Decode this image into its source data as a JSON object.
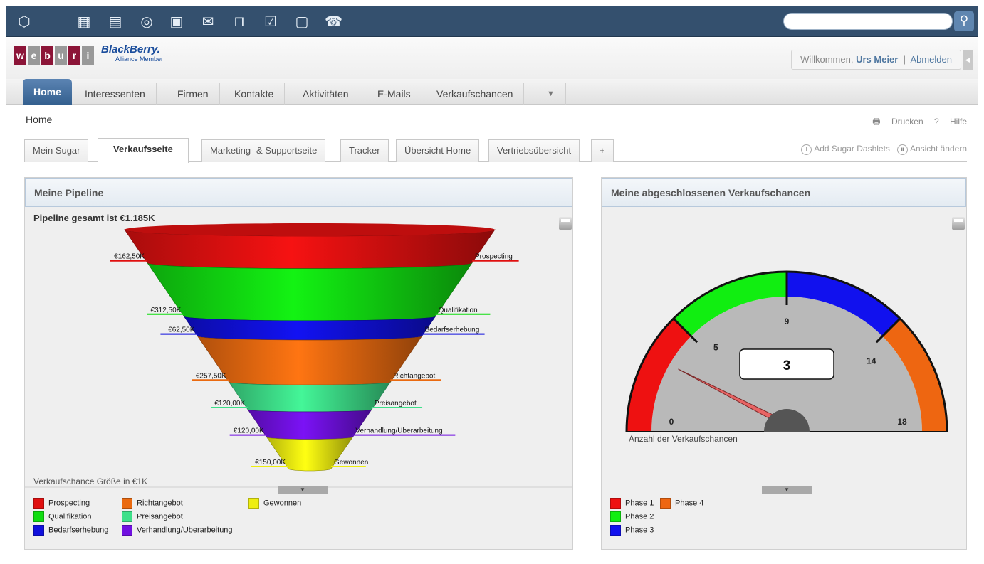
{
  "topbar": {
    "icons": [
      "cube-icon",
      "building-icon",
      "contact-card-icon",
      "coins-icon",
      "briefcase-icon",
      "envelope-icon",
      "clip-icon",
      "checklist-icon",
      "calendar-icon",
      "phone-icon"
    ],
    "search_placeholder": ""
  },
  "brand": {
    "logo_letters": [
      "w",
      "e",
      "b",
      "u",
      "r",
      "i"
    ],
    "logo_colors": [
      "#8c1538",
      "#999999",
      "#8c1538",
      "#999999",
      "#8c1538",
      "#999999"
    ],
    "partner_name": "BlackBerry.",
    "partner_sub": "Alliance Member"
  },
  "user": {
    "welcome": "Willkommen,",
    "name": "Urs Meier",
    "logout": "Abmelden"
  },
  "nav": {
    "tabs": [
      "Home",
      "Interessenten",
      "Firmen",
      "Kontakte",
      "Aktivitäten",
      "E-Mails",
      "Verkaufschancen"
    ],
    "active": "Home"
  },
  "page": {
    "title": "Home",
    "print": "Drucken",
    "help": "Hilfe"
  },
  "dashboard_tabs": {
    "tabs": [
      "Mein Sugar",
      "Verkaufsseite",
      "Marketing- & Supportseite",
      "Tracker",
      "Übersicht Home",
      "Vertriebsübersicht"
    ],
    "active": "Verkaufsseite",
    "add_label": "+",
    "add_dashlets": "Add Sugar Dashlets",
    "change_view": "Ansicht ändern"
  },
  "pipeline": {
    "header": "Meine Pipeline",
    "subtitle": "Pipeline gesamt ist €1.185K",
    "xlabel": "Verkaufschance Größe in €1K"
  },
  "gauge_dashlet": {
    "header": "Meine abgeschlossenen Verkaufschancen",
    "xlabel": "Anzahl der Verkaufschancen"
  },
  "chart_data": [
    {
      "type": "funnel",
      "title": "Pipeline gesamt ist €1.185K",
      "xlabel": "Verkaufschance Größe in €1K",
      "categories": [
        "Prospecting",
        "Qualifikation",
        "Bedarfserhebung",
        "Richtangebot",
        "Preisangebot",
        "Verhandlung/Überarbeitung",
        "Gewonnen"
      ],
      "values": [
        162.5,
        312.5,
        62.5,
        257.5,
        120.0,
        120.0,
        150.0
      ],
      "value_labels": [
        "€162,50K",
        "€312,50K",
        "€62,50K",
        "€257,50K",
        "€120,00K",
        "€120,00K",
        "€150,00K"
      ],
      "colors": [
        "#e01010",
        "#11dd11",
        "#1010dd",
        "#ea6a10",
        "#3ee08a",
        "#7010e0",
        "#eeee10"
      ],
      "legend_placement": "bottom"
    },
    {
      "type": "gauge",
      "xlabel": "Anzahl der Verkaufschancen",
      "value": 3,
      "range": [
        0,
        18
      ],
      "tick_labels": [
        "0",
        "5",
        "9",
        "14",
        "18"
      ],
      "phases": [
        {
          "name": "Phase 1",
          "from": 0,
          "to": 4.5,
          "color": "#ee1111"
        },
        {
          "name": "Phase 2",
          "from": 4.5,
          "to": 9,
          "color": "#11ee11"
        },
        {
          "name": "Phase 3",
          "from": 9,
          "to": 13.5,
          "color": "#1111ee"
        },
        {
          "name": "Phase 4",
          "from": 13.5,
          "to": 18,
          "color": "#ee6611"
        }
      ],
      "legend_placement": "bottom"
    }
  ]
}
